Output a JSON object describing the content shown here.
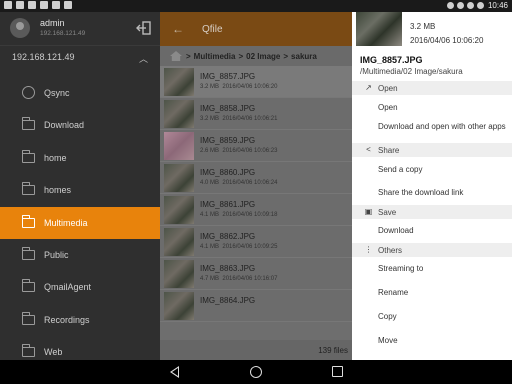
{
  "status_bar": {
    "time": "10:46"
  },
  "drawer": {
    "user": {
      "name": "admin",
      "ip": "192.168.121.49"
    },
    "server": "192.168.121.49",
    "items": [
      {
        "label": "Qsync",
        "icon": "sync-icon"
      },
      {
        "label": "Download",
        "icon": "folder-icon"
      },
      {
        "label": "home",
        "icon": "folder-icon"
      },
      {
        "label": "homes",
        "icon": "folder-icon"
      },
      {
        "label": "Multimedia",
        "icon": "folder-icon",
        "active": true
      },
      {
        "label": "Public",
        "icon": "folder-icon"
      },
      {
        "label": "QmailAgent",
        "icon": "folder-icon"
      },
      {
        "label": "Recordings",
        "icon": "folder-icon"
      },
      {
        "label": "Web",
        "icon": "folder-icon"
      }
    ]
  },
  "app": {
    "title": "Qfile"
  },
  "breadcrumb": [
    "Multimedia",
    "02 Image",
    "sakura"
  ],
  "files": [
    {
      "name": "IMG_8857.JPG",
      "size": "3.2 MB",
      "date": "2016/04/06 10:06:20"
    },
    {
      "name": "IMG_8858.JPG",
      "size": "3.2 MB",
      "date": "2016/04/06 10:06:21"
    },
    {
      "name": "IMG_8859.JPG",
      "size": "2.6 MB",
      "date": "2016/04/06 10:06:23"
    },
    {
      "name": "IMG_8860.JPG",
      "size": "4.0 MB",
      "date": "2016/04/06 10:06:24"
    },
    {
      "name": "IMG_8861.JPG",
      "size": "4.1 MB",
      "date": "2016/04/06 10:09:18"
    },
    {
      "name": "IMG_8862.JPG",
      "size": "4.1 MB",
      "date": "2016/04/06 10:09:25"
    },
    {
      "name": "IMG_8863.JPG",
      "size": "4.7 MB",
      "date": "2016/04/06 10:16:07"
    },
    {
      "name": "IMG_8864.JPG",
      "size": "",
      "date": ""
    }
  ],
  "file_count": "139 files",
  "sheet": {
    "size": "3.2 MB",
    "date": "2016/04/06 10:06:20",
    "filename": "IMG_8857.JPG",
    "path": "/Multimedia/02 Image/sakura",
    "sections": [
      {
        "title": "Open",
        "icon": "open-icon",
        "actions": [
          "Open",
          "Download and open with other apps"
        ]
      },
      {
        "title": "Share",
        "icon": "share-icon",
        "actions": [
          "Send a copy",
          "Share the download link"
        ]
      },
      {
        "title": "Save",
        "icon": "save-icon",
        "actions": [
          "Download"
        ]
      },
      {
        "title": "Others",
        "icon": "more-icon",
        "actions": [
          "Streaming to",
          "Rename",
          "Copy",
          "Move"
        ]
      }
    ]
  }
}
